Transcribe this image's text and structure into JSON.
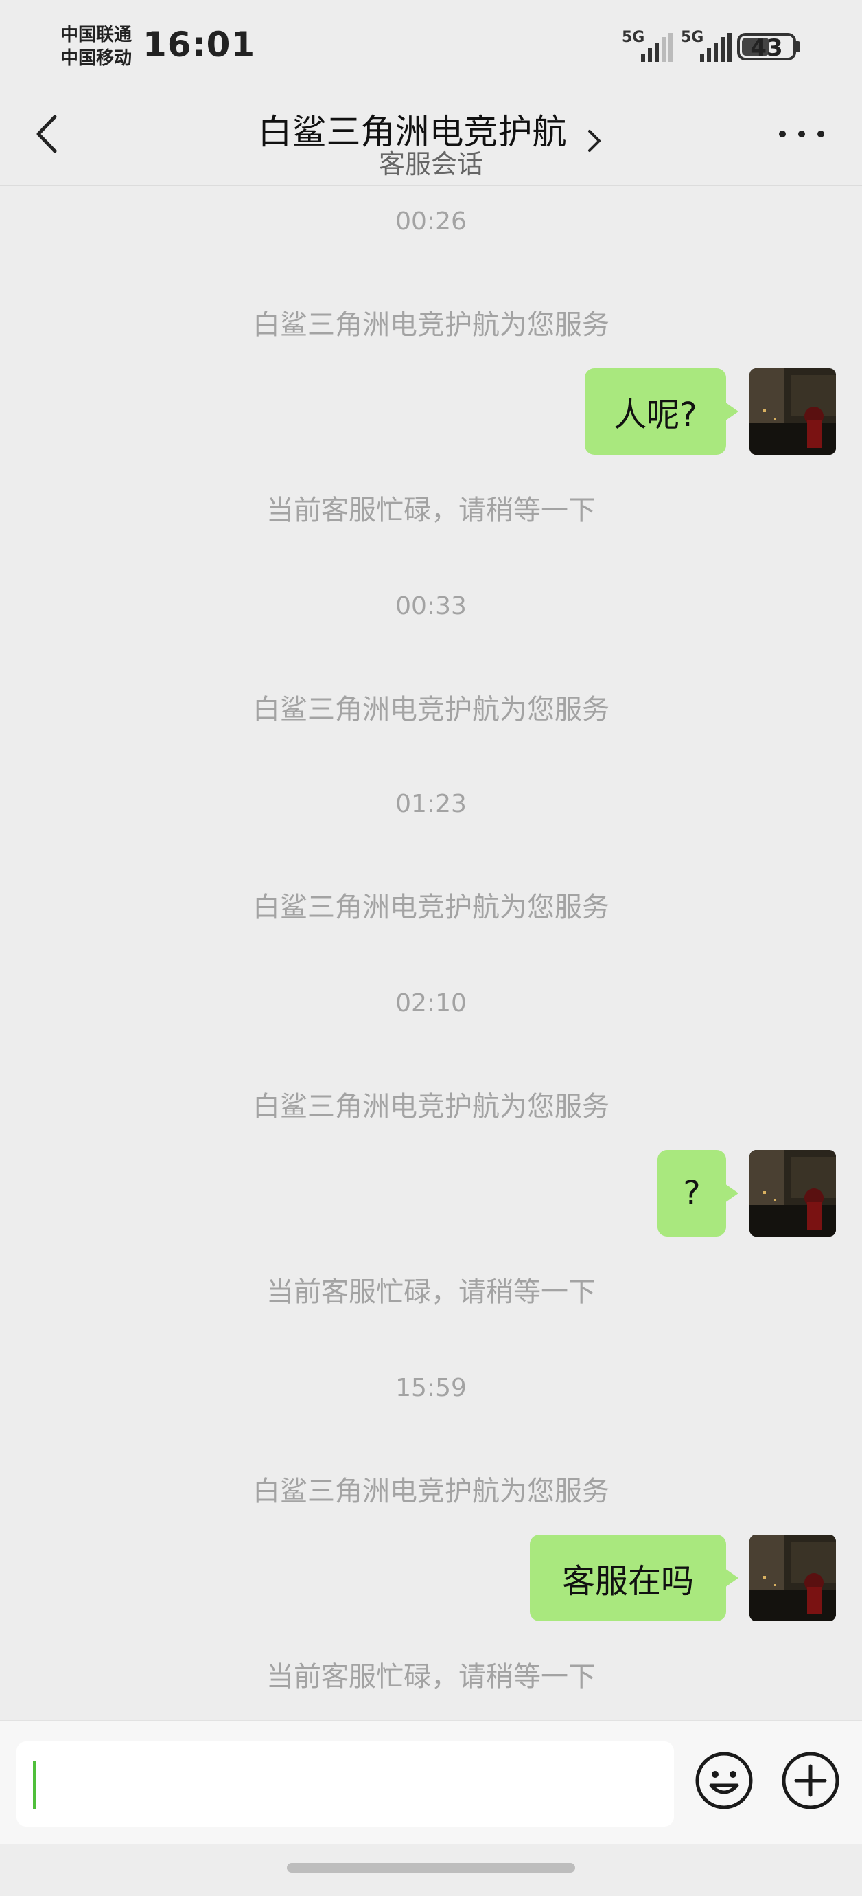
{
  "status_bar": {
    "carrier1": "中国联通",
    "carrier2": "中国移动",
    "time": "16:01",
    "network1": "5G",
    "network2": "5G",
    "battery": "43"
  },
  "header": {
    "title": "白鲨三角洲电竞护航",
    "subtitle": "客服会话"
  },
  "messages": {
    "ts1": "00:26",
    "sys1": "白鲨三角洲电竞护航为您服务",
    "me1": "人呢?",
    "busy1": "当前客服忙碌，请稍等一下",
    "ts2": "00:33",
    "sys2": "白鲨三角洲电竞护航为您服务",
    "ts3": "01:23",
    "sys3": "白鲨三角洲电竞护航为您服务",
    "ts4": "02:10",
    "sys4": "白鲨三角洲电竞护航为您服务",
    "me2": "?",
    "busy2": "当前客服忙碌，请稍等一下",
    "ts5": "15:59",
    "sys5": "白鲨三角洲电竞护航为您服务",
    "me3": "客服在吗",
    "busy3": "当前客服忙碌，请稍等一下"
  },
  "input": {
    "value": ""
  },
  "colors": {
    "background": "#ededed",
    "bubble": "#a9e87e",
    "system_text": "#a3a3a3",
    "caret": "#4fbf3b"
  },
  "icons": [
    "back-chevron-icon",
    "title-chevron-icon",
    "more-dots-icon",
    "emoji-icon",
    "plus-icon",
    "signal-icon",
    "battery-icon"
  ]
}
